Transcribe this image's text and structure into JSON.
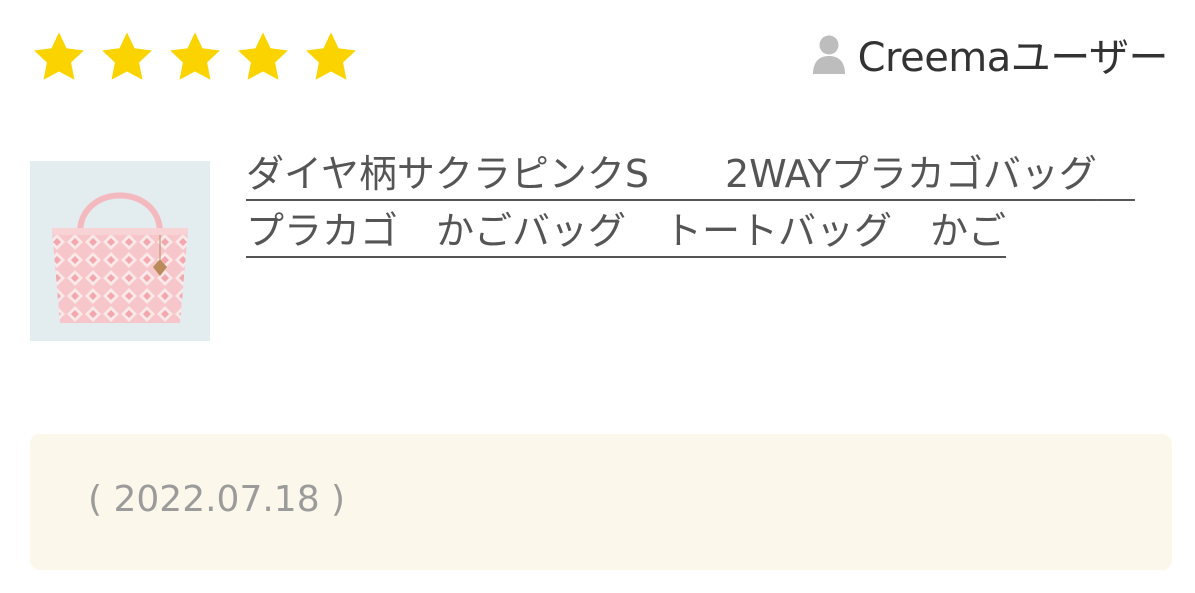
{
  "review": {
    "rating": 5,
    "max_rating": 5,
    "star_color": "#fbd400",
    "user_name": "Creemaユーザー",
    "product_title": "ダイヤ柄サクラピンクS　　2WAYプラカゴバッグ　プラカゴ　かごバッグ　トートバッグ　かご",
    "date": "( 2022.07.18 )"
  },
  "colors": {
    "comment_bg": "#fbf7ea",
    "link": "#555555",
    "date": "#9b9b9b",
    "user_icon": "#bdbdbd"
  },
  "icons": {
    "star": "star-icon",
    "user": "user-icon",
    "product": "product-thumbnail"
  }
}
